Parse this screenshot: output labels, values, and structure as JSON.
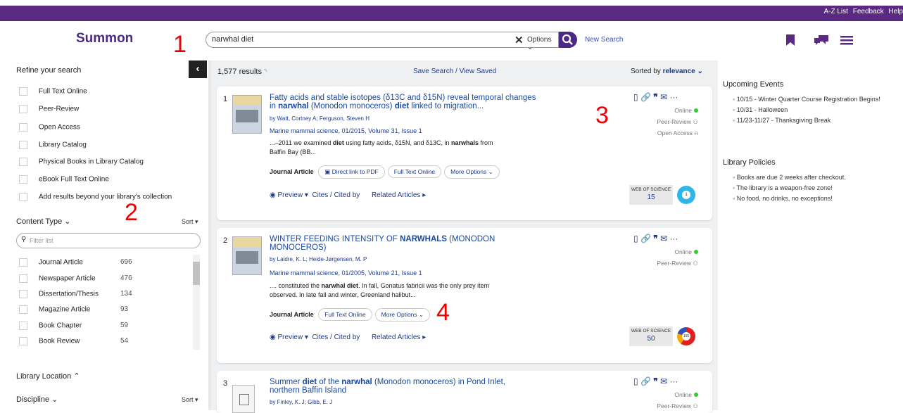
{
  "toplinks": {
    "az": "A-Z List",
    "feedback": "Feedback",
    "help": "Help"
  },
  "logo": "Summon",
  "search": {
    "value": "narwhal diet",
    "options": "Options ⌄",
    "new_search": "New Search"
  },
  "annotations": [
    "1",
    "2",
    "3",
    "4"
  ],
  "sidebar": {
    "refine": "Refine your search",
    "facets": [
      "Full Text Online",
      "Peer-Review",
      "Open Access",
      "Library Catalog",
      "Physical Books in Library Catalog",
      "eBook Full Text Online",
      "Add results beyond your library's collection"
    ],
    "content_type": "Content Type",
    "sort": "Sort ▾",
    "filter_placeholder": "Filter list",
    "content_types": [
      {
        "label": "Journal Article",
        "count": "696"
      },
      {
        "label": "Newspaper Article",
        "count": "476"
      },
      {
        "label": "Dissertation/Thesis",
        "count": "134"
      },
      {
        "label": "Magazine Article",
        "count": "93"
      },
      {
        "label": "Book Chapter",
        "count": "59"
      },
      {
        "label": "Book Review",
        "count": "54"
      }
    ],
    "library_location": "Library Location",
    "discipline": "Discipline"
  },
  "results": {
    "count": "1,577 results",
    "save": "Save Search / View Saved",
    "sorted_prefix": "Sorted by ",
    "sorted_value": "relevance ⌄"
  },
  "cards": [
    {
      "num": "1",
      "title_a": "Fatty acids and stable isotopes (δ13C and δ15N) reveal temporal changes in ",
      "title_b": "narwhal",
      "title_c": " (Monodon monoceros) ",
      "title_d": "diet",
      "title_e": " linked to migration...",
      "authors": "by Watt, Cortney A; Ferguson, Steven H",
      "journal": "Marine mammal science, 01/2015, Volume 31, Issue 1",
      "snippet_a": "...–2011 we examined ",
      "snippet_b": "diet",
      "snippet_c": " using fatty acids, δ15N, and δ13C, in ",
      "snippet_d": "narwhals",
      "snippet_e": " from Baffin Bay (BB...",
      "type": "Journal Article",
      "btn1": "Direct link to PDF",
      "btn2": "Full Text Online",
      "btn3": "More Options ⌄",
      "preview": "Preview ▾",
      "cites": "Cites / Cited by",
      "related": "Related Articles ▸",
      "online": "Online",
      "peer": "Peer-Review",
      "open": "Open Access",
      "wos": "WEB OF SCIENCE",
      "wos_n": "15",
      "altm": "1"
    },
    {
      "num": "2",
      "title_a": "WINTER FEEDING INTENSITY OF ",
      "title_b": "NARWHALS",
      "title_c": " (MONODON MONOCEROS)",
      "authors": "by Laidre, K. L; Heide-Jørgensen, M. P",
      "journal": "Marine mammal science, 01/2005, Volume 21, Issue 1",
      "snippet_a": ".... constituted the ",
      "snippet_b": "narwhal diet",
      "snippet_c": ". In fall, Gonatus fabricii was the only prey item observed. In late fall and winter, Greenland halibut...",
      "type": "Journal Article",
      "btn2": "Full Text Online",
      "btn3": "More Options ⌄",
      "preview": "Preview ▾",
      "cites": "Cites / Cited by",
      "related": "Related Articles ▸",
      "online": "Online",
      "peer": "Peer-Review",
      "wos": "WEB OF SCIENCE",
      "wos_n": "50",
      "altm": "165"
    },
    {
      "num": "3",
      "title_a": "Summer ",
      "title_b": "diet",
      "title_c": " of the ",
      "title_d": "narwhal",
      "title_e": " (Monodon monoceros) in Pond Inlet, northern Baffin Island",
      "authors": "by Finley, K. J; Gibb, E. J",
      "online": "Online",
      "peer": "Peer-Review"
    }
  ],
  "events": {
    "heading": "Upcoming Events",
    "items": [
      "10/15 - Winter Quarter Course Registration Begins!",
      "10/31 - Halloween",
      "11/23-11/27 - Thanksgiving Break"
    ]
  },
  "policies": {
    "heading": "Library Policies",
    "items": [
      "Books are due 2 weeks after checkout.",
      "The library is a weapon-free zone!",
      "No food, no drinks, no exceptions!"
    ]
  },
  "colors": {
    "brand": "#5a2a82",
    "link": "#1e3a8a",
    "annotation": "#ee0000"
  }
}
